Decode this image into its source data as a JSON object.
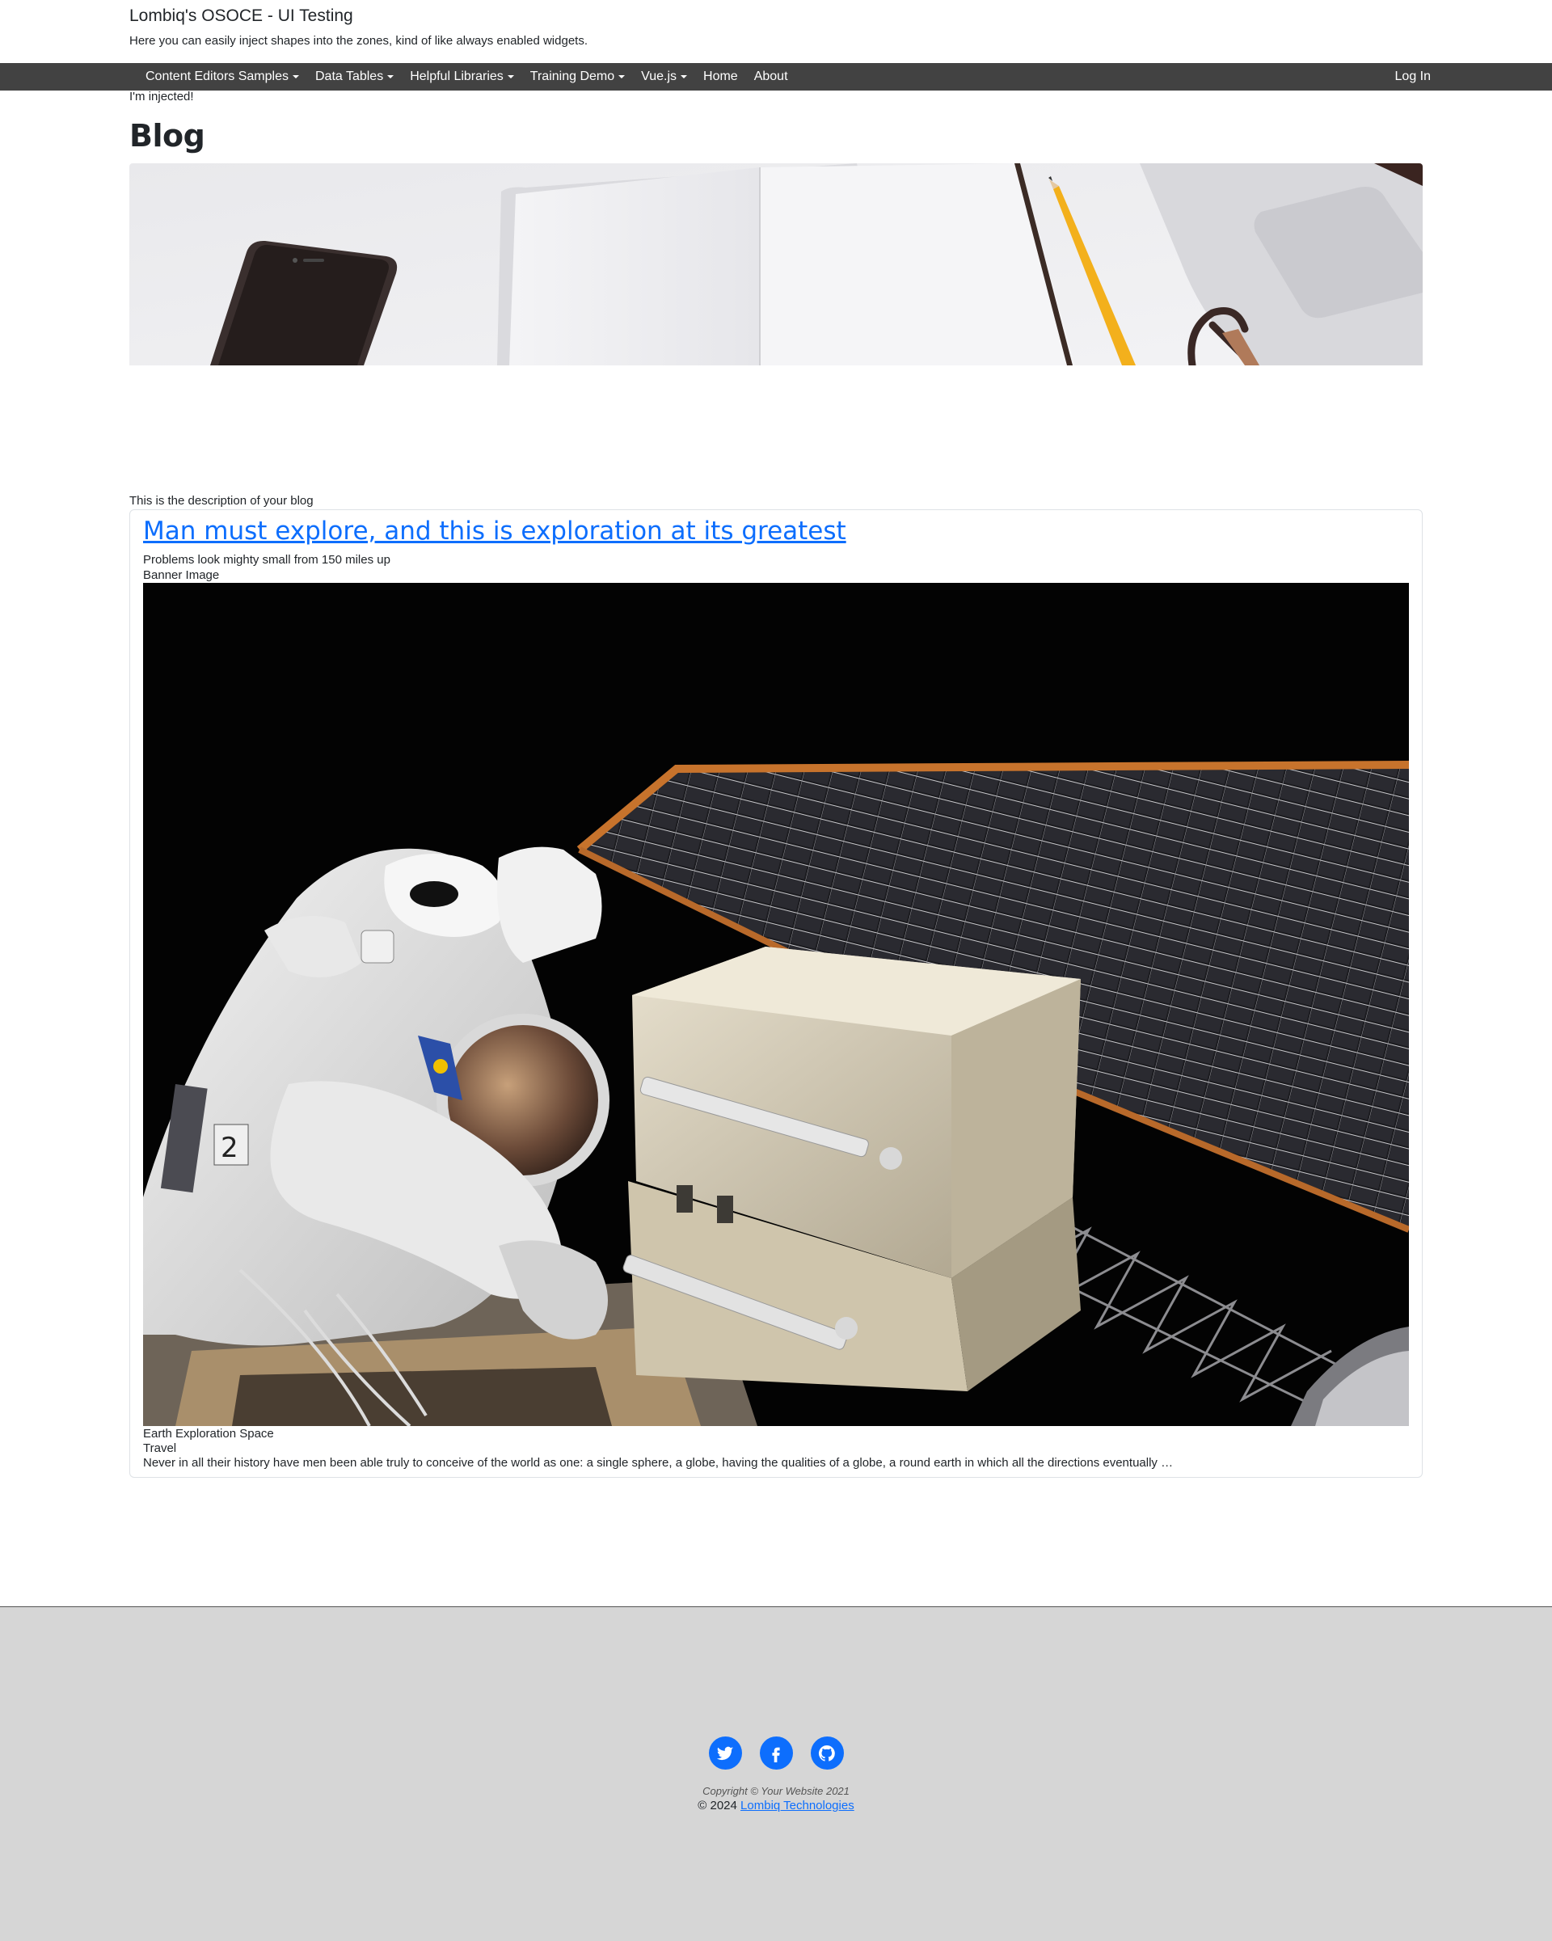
{
  "site": {
    "title": "Lombiq's OSOCE - UI Testing",
    "tagline": "Here you can easily inject shapes into the zones, kind of like always enabled widgets."
  },
  "navbar": {
    "items": [
      {
        "label": "Content Editors Samples",
        "dropdown": true
      },
      {
        "label": "Data Tables",
        "dropdown": true
      },
      {
        "label": "Helpful Libraries",
        "dropdown": true
      },
      {
        "label": "Training Demo",
        "dropdown": true
      },
      {
        "label": "Vue.js",
        "dropdown": true
      },
      {
        "label": "Home",
        "dropdown": false
      },
      {
        "label": "About",
        "dropdown": false
      }
    ],
    "login_label": "Log In",
    "background": "#424242"
  },
  "page": {
    "injected_text": "I'm injected!",
    "heading": "Blog",
    "hero_image": "desk-with-phone-notebook-pencil-glasses-laptop",
    "description": "This is the description of your blog"
  },
  "post": {
    "title": "Man must explore, and this is exploration at its greatest",
    "subtitle": "Problems look mighty small from 150 miles up",
    "banner_label": "Banner Image",
    "image": "astronaut-spacewalk-solar-panel",
    "tags": "Earth Exploration Space",
    "category": "Travel",
    "excerpt": "Never in all their history have men been able truly to conceive of the world as one: a single sphere, a globe, having the qualities of a globe, a round earth in which all the directions eventually …"
  },
  "footer": {
    "social": [
      {
        "icon": "twitter-icon"
      },
      {
        "icon": "facebook-icon"
      },
      {
        "icon": "github-icon"
      }
    ],
    "copyright": "Copyright © Your Website 2021",
    "credit_prefix": "© 2024",
    "credit_link": "Lombiq Technologies",
    "background": "#d6d6d6",
    "accent": "#0d6efd"
  }
}
